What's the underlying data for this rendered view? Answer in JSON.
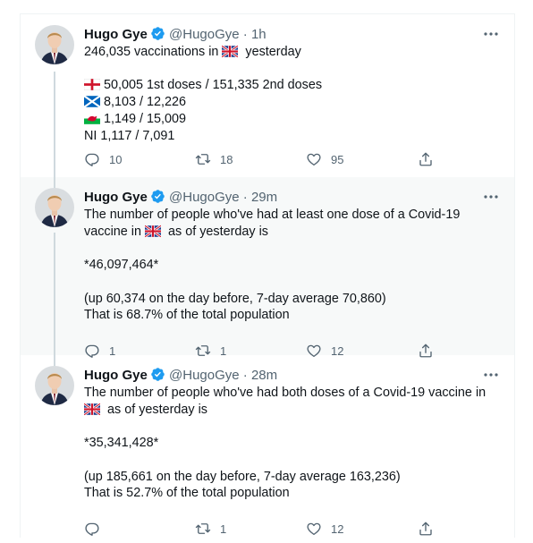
{
  "tweets": [
    {
      "name": "Hugo Gye",
      "handle": "@HugoGye",
      "sep": "·",
      "time": "1h",
      "lines": {
        "intro_a": "246,035 vaccinations in",
        "intro_b": " yesterday",
        "eng": "50,005 1st doses / 151,335 2nd doses",
        "sco": "8,103 / 12,226",
        "wal": "1,149 / 15,009",
        "ni": "NI 1,117 / 7,091"
      },
      "replies": "10",
      "retweets": "18",
      "likes": "95"
    },
    {
      "name": "Hugo Gye",
      "handle": "@HugoGye",
      "sep": "·",
      "time": "29m",
      "lines": {
        "l1": "The number of people who've had at least one dose of a Covid-19",
        "l2a": "vaccine in",
        "l2b": " as of yesterday is",
        "l3": "*46,097,464*",
        "l4": "(up 60,374 on the day before, 7-day average 70,860)",
        "l5": "That is 68.7% of the total population"
      },
      "replies": "1",
      "retweets": "1",
      "likes": "12"
    },
    {
      "name": "Hugo Gye",
      "handle": "@HugoGye",
      "sep": "·",
      "time": "28m",
      "lines": {
        "l1": "The number of people who've had both doses of a Covid-19 vaccine in",
        "l2": " as of yesterday is",
        "l3": "*35,341,428*",
        "l4": "(up 185,661 on the day before, 7-day average 163,236)",
        "l5": "That is 52.7% of the total population"
      },
      "replies": "",
      "retweets": "1",
      "likes": "12"
    }
  ],
  "icons": {
    "reply": "reply-icon",
    "retweet": "retweet-icon",
    "like": "like-icon",
    "share": "share-icon",
    "more": "more-icon",
    "verified": "verified-badge-icon"
  },
  "colors": {
    "text": "#0f1419",
    "secondary": "#536471",
    "verified": "#1d9bf0",
    "thread_line": "#cfd9de",
    "highlight_bg": "#f7f9f9"
  }
}
